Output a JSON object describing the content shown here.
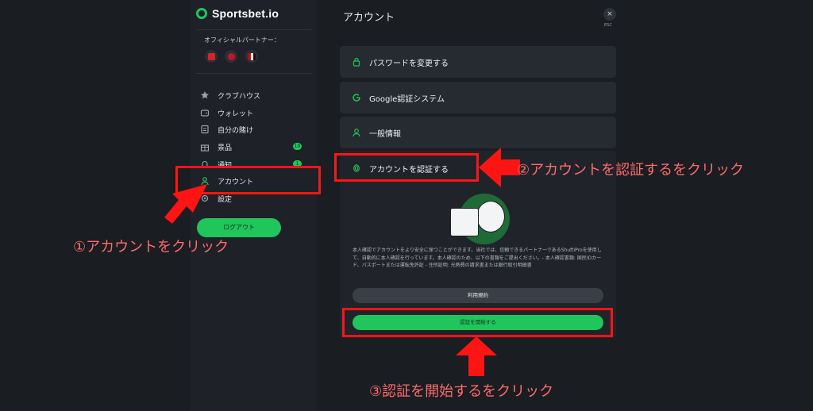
{
  "brand": {
    "name": "Sportsbet.io"
  },
  "sidebar": {
    "partner_label": "オフィシャルパートナー：",
    "items": [
      {
        "label": "クラブハウス",
        "icon": "star-icon"
      },
      {
        "label": "ウォレット",
        "icon": "wallet-icon"
      },
      {
        "label": "自分の賭け",
        "icon": "bets-icon"
      },
      {
        "label": "景品",
        "icon": "gift-icon",
        "badge": "10"
      },
      {
        "label": "通知",
        "icon": "bell-icon",
        "badge": "1"
      },
      {
        "label": "アカウント",
        "icon": "user-icon"
      },
      {
        "label": "設定",
        "icon": "gear-icon"
      }
    ],
    "logout": "ログアウト"
  },
  "main": {
    "title": "アカウント",
    "close": "×",
    "esc": "ESC",
    "cards": [
      {
        "label": "パスワードを変更する",
        "icon": "lock-icon"
      },
      {
        "label": "Google認証システム",
        "icon": "google-auth-icon"
      },
      {
        "label": "一般情報",
        "icon": "user-icon"
      }
    ],
    "verify": {
      "label": "アカウントを認証する",
      "icon": "fingerprint-icon",
      "description": "本人確認でアカウントをより安全に保つことができます。当社では、信頼できるパートナーであるShuftiProを使用して、自動的に本人確認を行っています。本人確認のため、以下の書類をご提出ください。- 本人確認書類: 国民IDカード、パスポートまたは運転免許証 - 住所証明: 光熱費の請求書または銀行取引明細書",
      "terms_button": "利用規約",
      "start_button": "認証を開始する"
    }
  },
  "annotations": {
    "step1": "①アカウントをクリック",
    "step2": "②アカウントを認証するをクリック",
    "step3": "③認証を開始するをクリック",
    "color": "#ff1414"
  },
  "colors": {
    "accent": "#20c55b",
    "background": "#1a1d22",
    "card": "#262a31"
  }
}
